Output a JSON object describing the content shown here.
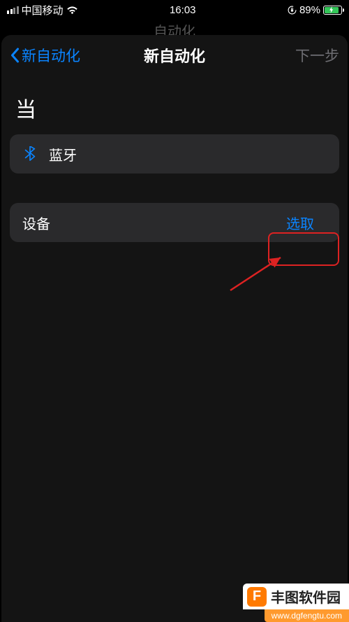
{
  "status_bar": {
    "carrier": "中国移动",
    "time": "16:03",
    "battery_percent": "89%"
  },
  "underlying_title": "自动化",
  "nav": {
    "back": "新自动化",
    "title": "新自动化",
    "next": "下一步"
  },
  "section_header": "当",
  "trigger_row": {
    "icon": "bluetooth-icon",
    "label": "蓝牙"
  },
  "device_row": {
    "label": "设备",
    "select_label": "选取"
  },
  "watermark": {
    "brand": "丰图软件园",
    "logo_letter": "F",
    "url": "www.dgfengtu.com"
  },
  "colors": {
    "accent": "#0a84ff",
    "disabled": "#6e6e73",
    "annotate": "#d22",
    "battery_charging": "#34c759",
    "wm_orange": "#ff7a00"
  }
}
